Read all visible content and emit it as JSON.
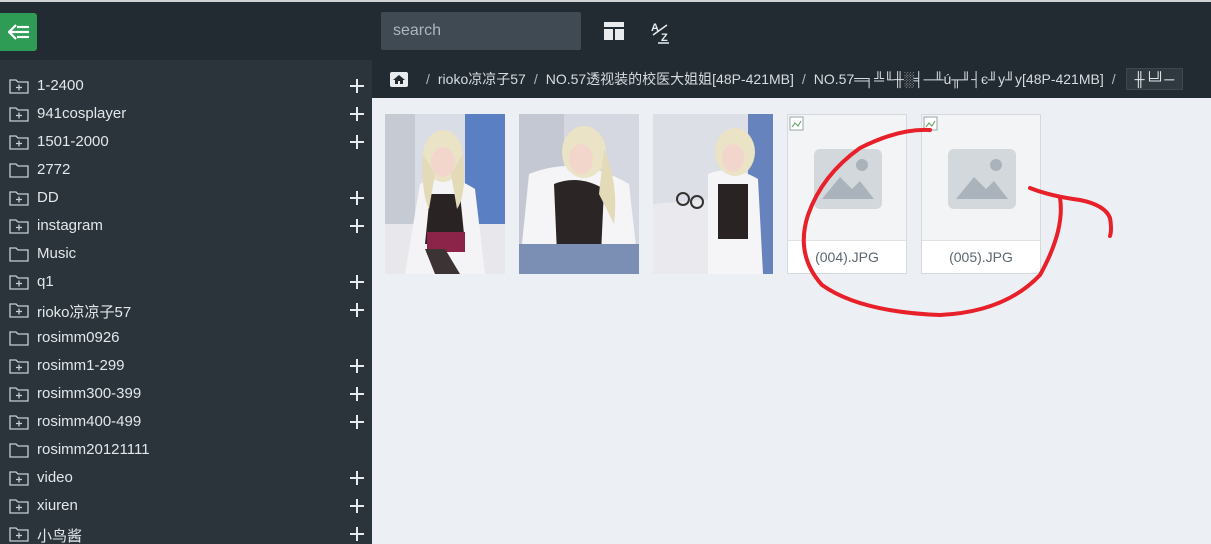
{
  "topbar": {
    "back_icon": "back-arrow-icon",
    "search_placeholder": "search",
    "layout_icon": "layout-grid-icon",
    "sort_icon": "sort-az-icon",
    "colors": {
      "bar": "#222b31",
      "accent": "#2e9c55"
    }
  },
  "sidebar": {
    "items": [
      {
        "label": "1-2400",
        "expandable": true
      },
      {
        "label": "941cosplayer",
        "expandable": true
      },
      {
        "label": "1501-2000",
        "expandable": true
      },
      {
        "label": "2772",
        "expandable": false
      },
      {
        "label": "DD",
        "expandable": true
      },
      {
        "label": "instagram",
        "expandable": true
      },
      {
        "label": "Music",
        "expandable": false
      },
      {
        "label": "q1",
        "expandable": true
      },
      {
        "label": "rioko凉凉子57",
        "expandable": true
      },
      {
        "label": "rosimm0926",
        "expandable": false
      },
      {
        "label": "rosimm1-299",
        "expandable": true
      },
      {
        "label": "rosimm300-399",
        "expandable": true
      },
      {
        "label": "rosimm400-499",
        "expandable": true
      },
      {
        "label": "rosimm20121111",
        "expandable": false
      },
      {
        "label": "video",
        "expandable": true
      },
      {
        "label": "xiuren",
        "expandable": true
      },
      {
        "label": "小鸟酱",
        "expandable": true
      }
    ]
  },
  "breadcrumb": {
    "home_icon": "home-icon",
    "separator": "/",
    "items": [
      "rioko凉凉子57",
      "NO.57透视装的校医大姐姐[48P-421MB]",
      "NO.57═╕╩╙╫░╡─╨ú╥╜┤є╜у╜у[48P-421MB]"
    ],
    "current": "╫╘╝─"
  },
  "files": [
    {
      "type": "image",
      "name": ""
    },
    {
      "type": "image",
      "name": ""
    },
    {
      "type": "image",
      "name": ""
    },
    {
      "type": "broken",
      "name": "(004).JPG"
    },
    {
      "type": "broken",
      "name": "(005).JPG"
    }
  ],
  "annotation": {
    "shape": "freehand-circle",
    "color": "#e8202a",
    "target": "(005).JPG"
  }
}
